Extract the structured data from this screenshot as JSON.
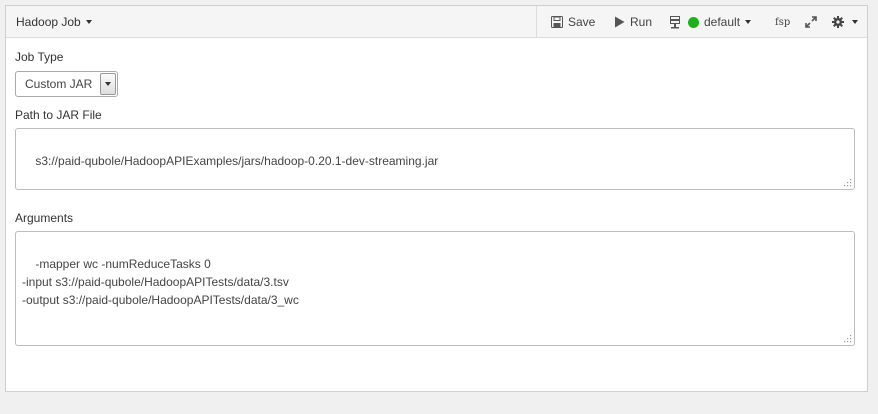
{
  "toolbar": {
    "job_menu_label": "Hadoop Job",
    "save_label": "Save",
    "run_label": "Run",
    "cluster_label": "default",
    "cluster_status_color": "#19b319",
    "fsp_label": "fsp",
    "icons": [
      "save-icon",
      "play-icon",
      "server-icon",
      "status-dot-icon",
      "expand-icon",
      "gear-icon"
    ]
  },
  "form": {
    "job_type_label": "Job Type",
    "job_type_value": "Custom JAR",
    "jar_path_label": "Path to JAR File",
    "jar_path_value": "s3://paid-qubole/HadoopAPIExamples/jars/hadoop-0.20.1-dev-streaming.jar",
    "arguments_label": "Arguments",
    "arguments_value": "-mapper wc -numReduceTasks 0\n-input s3://paid-qubole/HadoopAPITests/data/3.tsv\n-output s3://paid-qubole/HadoopAPITests/data/3_wc"
  }
}
